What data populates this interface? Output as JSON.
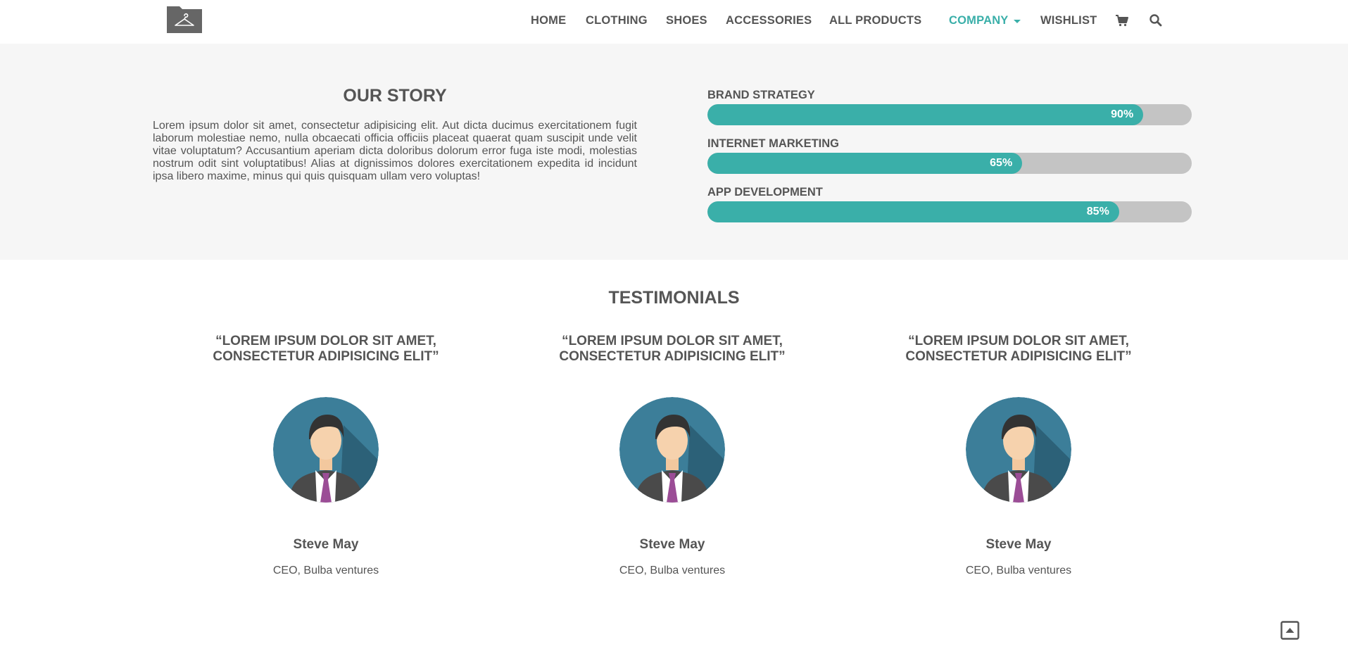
{
  "header": {
    "logo_icon": "hanger-icon",
    "nav": [
      {
        "label": "HOME",
        "active": false
      },
      {
        "label": "CLOTHING",
        "active": false
      },
      {
        "label": "SHOES",
        "active": false
      },
      {
        "label": "ACCESSORIES",
        "active": false
      },
      {
        "label": "ALL PRODUCTS",
        "active": false
      },
      {
        "label": "COMPANY",
        "active": true,
        "has_dropdown": true
      },
      {
        "label": "WISHLIST",
        "active": false
      }
    ],
    "icons": [
      "cart-icon",
      "search-icon"
    ]
  },
  "story": {
    "title": "OUR STORY",
    "text": "Lorem ipsum dolor sit amet, consectetur adipisicing elit. Aut dicta ducimus exercitationem fugit laborum molestiae nemo, nulla obcaecati officia officiis placeat quaerat quam suscipit unde velit vitae voluptatum? Accusantium aperiam dicta doloribus dolorum error fuga iste modi, molestias nostrum odit sint voluptatibus! Alias at dignissimos dolores exercitationem expedita id incidunt ipsa libero maxime, minus qui quis quisquam ullam vero voluptas!"
  },
  "skills": [
    {
      "label": "BRAND STRATEGY",
      "percent": 90,
      "percent_label": "90%"
    },
    {
      "label": "INTERNET MARKETING",
      "percent": 65,
      "percent_label": "65%"
    },
    {
      "label": "APP DEVELOPMENT",
      "percent": 85,
      "percent_label": "85%"
    }
  ],
  "testimonials": {
    "title": "TESTIMONIALS",
    "items": [
      {
        "quote": "“LOREM IPSUM DOLOR SIT AMET, CONSECTETUR ADIPISICING ELIT”",
        "name": "Steve May",
        "role": "CEO, Bulba ventures"
      },
      {
        "quote": "“LOREM IPSUM DOLOR SIT AMET, CONSECTETUR ADIPISICING ELIT”",
        "name": "Steve May",
        "role": "CEO, Bulba ventures"
      },
      {
        "quote": "“LOREM IPSUM DOLOR SIT AMET, CONSECTETUR ADIPISICING ELIT”",
        "name": "Steve May",
        "role": "CEO, Bulba ventures"
      }
    ]
  },
  "colors": {
    "accent": "#3aafa9",
    "text": "#555555",
    "track": "#c4c4c4",
    "band": "#f6f6f6"
  },
  "scroll_top_icon": "arrow-up-box-icon"
}
